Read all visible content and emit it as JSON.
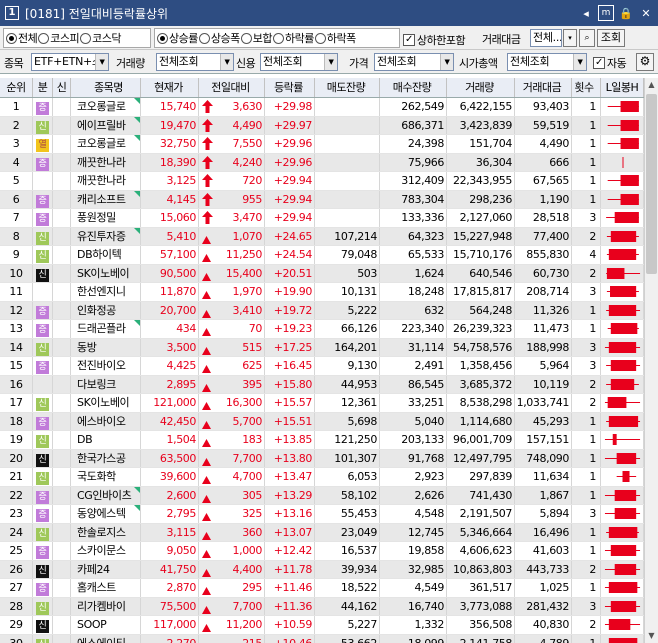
{
  "title": {
    "number": "1",
    "code": "[0181]",
    "name": "전일대비등락률상위",
    "btn_m": "m",
    "btn_lock": "🔒",
    "btn_close": "✕",
    "btn_more": "◂"
  },
  "filters": {
    "market": [
      {
        "label": "전체",
        "on": true
      },
      {
        "label": "코스피",
        "on": false
      },
      {
        "label": "코스닥",
        "on": false
      }
    ],
    "type": [
      {
        "label": "상승률",
        "on": true
      },
      {
        "label": "상승폭",
        "on": false
      },
      {
        "label": "보합",
        "on": false
      },
      {
        "label": "하락률",
        "on": false
      },
      {
        "label": "하락폭",
        "on": false
      }
    ],
    "include_limit": "상하한포함",
    "trade_amount_label": "거래대금",
    "trade_amount_value": "전체...",
    "query_button": "조회",
    "item_label": "종목",
    "item_value": "ETF+ETN+스!",
    "volume_label": "거래량",
    "volume_value": "전체조회",
    "credit_label": "신용",
    "credit_value": "전체조회",
    "price_label": "가격",
    "price_value": "전체조회",
    "mcap_label": "시가총액",
    "mcap_value": "전체조회",
    "auto_label": "자동"
  },
  "columns": [
    "순위",
    "분",
    "신",
    "종목명",
    "현재가",
    "전일대비",
    "등락률",
    "매도잔량",
    "매수잔량",
    "거래량",
    "거래대금",
    "횟수",
    "L일봉H"
  ],
  "rows": [
    {
      "rank": "1",
      "badge": "증",
      "bc": "p",
      "name": "코오롱글로",
      "corner": true,
      "price": "15,740",
      "arrow": "up",
      "chg": "3,630",
      "rate": "+29.98",
      "ask": "",
      "bid": "262,549",
      "vol": "6,422,155",
      "amt": "93,403",
      "cnt": "1",
      "k": [
        0.12,
        0.92,
        0.45,
        0.92
      ]
    },
    {
      "rank": "2",
      "badge": "신",
      "bc": "g",
      "name": "에이프릴바",
      "corner": true,
      "price": "19,470",
      "arrow": "up",
      "chg": "4,490",
      "rate": "+29.97",
      "ask": "",
      "bid": "686,371",
      "vol": "3,423,839",
      "amt": "59,519",
      "cnt": "1",
      "k": [
        0.12,
        0.92,
        0.45,
        0.92
      ]
    },
    {
      "rank": "3",
      "badge": "열",
      "bc": "y",
      "name": "코오롱글로",
      "corner": true,
      "price": "32,750",
      "arrow": "up",
      "chg": "7,550",
      "rate": "+29.96",
      "ask": "",
      "bid": "24,398",
      "vol": "151,704",
      "amt": "4,490",
      "cnt": "1",
      "k": [
        0.12,
        0.92,
        0.45,
        0.92
      ]
    },
    {
      "rank": "4",
      "badge": "증",
      "bc": "p",
      "name": "깨끗한나라",
      "corner": false,
      "price": "18,390",
      "arrow": "up",
      "chg": "4,240",
      "rate": "+29.96",
      "ask": "",
      "bid": "75,966",
      "vol": "36,304",
      "amt": "666",
      "cnt": "1",
      "k": [
        0.5,
        0.52,
        0.5,
        0.52
      ]
    },
    {
      "rank": "5",
      "badge": "",
      "bc": "",
      "name": "깨끗한나라",
      "corner": false,
      "price": "3,125",
      "arrow": "up",
      "chg": "720",
      "rate": "+29.94",
      "ask": "",
      "bid": "312,409",
      "vol": "22,343,955",
      "amt": "67,565",
      "cnt": "1",
      "k": [
        0.12,
        0.92,
        0.45,
        0.92
      ]
    },
    {
      "rank": "6",
      "badge": "증",
      "bc": "p",
      "name": "캐리소프트",
      "corner": true,
      "price": "4,145",
      "arrow": "up",
      "chg": "955",
      "rate": "+29.94",
      "ask": "",
      "bid": "783,304",
      "vol": "298,236",
      "amt": "1,190",
      "cnt": "1",
      "k": [
        0.12,
        0.92,
        0.45,
        0.92
      ]
    },
    {
      "rank": "7",
      "badge": "증",
      "bc": "p",
      "name": "풍원정밀",
      "corner": false,
      "price": "15,060",
      "arrow": "up",
      "chg": "3,470",
      "rate": "+29.94",
      "ask": "",
      "bid": "133,336",
      "vol": "2,127,060",
      "amt": "28,518",
      "cnt": "3",
      "k": [
        0.08,
        0.92,
        0.3,
        0.92
      ]
    },
    {
      "rank": "8",
      "badge": "신",
      "bc": "g",
      "name": "유진투자증",
      "corner": true,
      "price": "5,410",
      "arrow": "tri",
      "chg": "1,070",
      "rate": "+24.65",
      "ask": "107,214",
      "bid": "64,323",
      "vol": "15,227,948",
      "amt": "77,400",
      "cnt": "2",
      "k": [
        0.1,
        0.92,
        0.2,
        0.85
      ]
    },
    {
      "rank": "9",
      "badge": "신",
      "bc": "g",
      "name": "DB하이텍",
      "corner": false,
      "price": "57,100",
      "arrow": "tri",
      "chg": "11,250",
      "rate": "+24.54",
      "ask": "79,048",
      "bid": "65,533",
      "vol": "15,710,176",
      "amt": "855,830",
      "cnt": "4",
      "k": [
        0.1,
        0.92,
        0.15,
        0.85
      ]
    },
    {
      "rank": "10",
      "badge": "신",
      "bc": "k",
      "name": "SK이노베이",
      "corner": false,
      "price": "90,500",
      "arrow": "tri",
      "chg": "15,400",
      "rate": "+20.51",
      "ask": "503",
      "bid": "1,624",
      "vol": "640,546",
      "amt": "60,730",
      "cnt": "2",
      "k": [
        0.08,
        0.95,
        0.1,
        0.55
      ]
    },
    {
      "rank": "11",
      "badge": "",
      "bc": "",
      "name": "한선엔지니",
      "corner": false,
      "price": "11,870",
      "arrow": "tri",
      "chg": "1,970",
      "rate": "+19.90",
      "ask": "10,131",
      "bid": "18,248",
      "vol": "17,815,817",
      "amt": "208,714",
      "cnt": "3",
      "k": [
        0.1,
        0.92,
        0.18,
        0.85
      ]
    },
    {
      "rank": "12",
      "badge": "증",
      "bc": "p",
      "name": "인화정공",
      "corner": false,
      "price": "20,700",
      "arrow": "tri",
      "chg": "3,410",
      "rate": "+19.72",
      "ask": "5,222",
      "bid": "632",
      "vol": "564,248",
      "amt": "11,326",
      "cnt": "1",
      "k": [
        0.08,
        0.95,
        0.15,
        0.85
      ]
    },
    {
      "rank": "13",
      "badge": "증",
      "bc": "p",
      "name": "드래곤플라",
      "corner": true,
      "price": "434",
      "arrow": "tri",
      "chg": "70",
      "rate": "+19.23",
      "ask": "66,126",
      "bid": "223,340",
      "vol": "26,239,323",
      "amt": "11,473",
      "cnt": "1",
      "k": [
        0.12,
        0.92,
        0.2,
        0.88
      ]
    },
    {
      "rank": "14",
      "badge": "신",
      "bc": "g",
      "name": "동방",
      "corner": false,
      "price": "3,500",
      "arrow": "tri",
      "chg": "515",
      "rate": "+17.25",
      "ask": "164,201",
      "bid": "31,114",
      "vol": "54,758,576",
      "amt": "188,998",
      "cnt": "3",
      "k": [
        0.05,
        0.95,
        0.15,
        0.85
      ]
    },
    {
      "rank": "15",
      "badge": "증",
      "bc": "p",
      "name": "전진바이오",
      "corner": false,
      "price": "4,425",
      "arrow": "tri",
      "chg": "625",
      "rate": "+16.45",
      "ask": "9,130",
      "bid": "2,491",
      "vol": "1,358,456",
      "amt": "5,964",
      "cnt": "3",
      "k": [
        0.08,
        0.95,
        0.2,
        0.85
      ]
    },
    {
      "rank": "16",
      "badge": "",
      "bc": "",
      "name": "다보링크",
      "corner": false,
      "price": "2,895",
      "arrow": "tri",
      "chg": "395",
      "rate": "+15.80",
      "ask": "44,953",
      "bid": "86,545",
      "vol": "3,685,372",
      "amt": "10,119",
      "cnt": "2",
      "k": [
        0.08,
        0.92,
        0.2,
        0.8
      ]
    },
    {
      "rank": "17",
      "badge": "신",
      "bc": "g",
      "name": "SK이노베이",
      "corner": false,
      "price": "121,000",
      "arrow": "tri",
      "chg": "16,300",
      "rate": "+15.57",
      "ask": "12,361",
      "bid": "33,251",
      "vol": "8,538,298",
      "amt": "1,033,741",
      "cnt": "2",
      "k": [
        0.05,
        0.95,
        0.12,
        0.6
      ]
    },
    {
      "rank": "18",
      "badge": "증",
      "bc": "p",
      "name": "에스바이오",
      "corner": false,
      "price": "42,450",
      "arrow": "tri",
      "chg": "5,700",
      "rate": "+15.51",
      "ask": "5,698",
      "bid": "5,040",
      "vol": "1,114,680",
      "amt": "45,293",
      "cnt": "1",
      "k": [
        0.08,
        0.95,
        0.15,
        0.9
      ]
    },
    {
      "rank": "19",
      "badge": "신",
      "bc": "g",
      "name": "DB",
      "corner": false,
      "price": "1,504",
      "arrow": "tri",
      "chg": "183",
      "rate": "+13.85",
      "ask": "121,250",
      "bid": "203,133",
      "vol": "96,001,709",
      "amt": "157,151",
      "cnt": "1",
      "k": [
        0.05,
        0.95,
        0.25,
        0.35
      ]
    },
    {
      "rank": "20",
      "badge": "신",
      "bc": "k",
      "name": "한국가스공",
      "corner": false,
      "price": "63,500",
      "arrow": "tri",
      "chg": "7,700",
      "rate": "+13.80",
      "ask": "101,307",
      "bid": "91,768",
      "vol": "12,497,795",
      "amt": "748,090",
      "cnt": "1",
      "k": [
        0.05,
        0.95,
        0.35,
        0.85
      ]
    },
    {
      "rank": "21",
      "badge": "신",
      "bc": "g",
      "name": "국도화학",
      "corner": false,
      "price": "39,600",
      "arrow": "tri",
      "chg": "4,700",
      "rate": "+13.47",
      "ask": "6,053",
      "bid": "2,923",
      "vol": "297,839",
      "amt": "11,634",
      "cnt": "1",
      "k": [
        0.35,
        0.85,
        0.5,
        0.68
      ]
    },
    {
      "rank": "22",
      "badge": "증",
      "bc": "p",
      "name": "CG인바이츠",
      "corner": true,
      "price": "2,600",
      "arrow": "tri",
      "chg": "305",
      "rate": "+13.29",
      "ask": "58,102",
      "bid": "2,626",
      "vol": "741,430",
      "amt": "1,867",
      "cnt": "1",
      "k": [
        0.05,
        0.95,
        0.3,
        0.85
      ]
    },
    {
      "rank": "23",
      "badge": "증",
      "bc": "p",
      "name": "동양에스텍",
      "corner": true,
      "price": "2,795",
      "arrow": "tri",
      "chg": "325",
      "rate": "+13.16",
      "ask": "55,453",
      "bid": "4,548",
      "vol": "2,191,507",
      "amt": "5,894",
      "cnt": "3",
      "k": [
        0.05,
        0.95,
        0.3,
        0.85
      ]
    },
    {
      "rank": "24",
      "badge": "신",
      "bc": "g",
      "name": "한솔로지스",
      "corner": false,
      "price": "3,115",
      "arrow": "tri",
      "chg": "360",
      "rate": "+13.07",
      "ask": "23,049",
      "bid": "12,745",
      "vol": "5,346,664",
      "amt": "16,496",
      "cnt": "1",
      "k": [
        0.08,
        0.92,
        0.15,
        0.88
      ]
    },
    {
      "rank": "25",
      "badge": "증",
      "bc": "p",
      "name": "스카이문스",
      "corner": false,
      "price": "9,050",
      "arrow": "tri",
      "chg": "1,000",
      "rate": "+12.42",
      "ask": "16,537",
      "bid": "19,858",
      "vol": "4,606,623",
      "amt": "41,603",
      "cnt": "1",
      "k": [
        0.05,
        0.95,
        0.2,
        0.85
      ]
    },
    {
      "rank": "26",
      "badge": "신",
      "bc": "k",
      "name": "카페24",
      "corner": false,
      "price": "41,750",
      "arrow": "tri",
      "chg": "4,400",
      "rate": "+11.78",
      "ask": "39,934",
      "bid": "32,985",
      "vol": "10,863,803",
      "amt": "443,733",
      "cnt": "2",
      "k": [
        0.05,
        0.95,
        0.3,
        0.85
      ]
    },
    {
      "rank": "27",
      "badge": "증",
      "bc": "p",
      "name": "홈캐스트",
      "corner": false,
      "price": "2,870",
      "arrow": "tri",
      "chg": "295",
      "rate": "+11.46",
      "ask": "18,522",
      "bid": "4,549",
      "vol": "361,517",
      "amt": "1,025",
      "cnt": "1",
      "k": [
        0.05,
        0.95,
        0.15,
        0.88
      ]
    },
    {
      "rank": "28",
      "badge": "신",
      "bc": "g",
      "name": "리가켐바이",
      "corner": false,
      "price": "75,500",
      "arrow": "tri",
      "chg": "7,700",
      "rate": "+11.36",
      "ask": "44,162",
      "bid": "16,740",
      "vol": "3,773,088",
      "amt": "281,432",
      "cnt": "3",
      "k": [
        0.05,
        0.95,
        0.2,
        0.85
      ]
    },
    {
      "rank": "29",
      "badge": "신",
      "bc": "k",
      "name": "SOOP",
      "corner": false,
      "price": "117,000",
      "arrow": "tri",
      "chg": "11,200",
      "rate": "+10.59",
      "ask": "5,227",
      "bid": "1,332",
      "vol": "356,508",
      "amt": "40,830",
      "cnt": "2",
      "k": [
        0.05,
        0.95,
        0.15,
        0.7
      ]
    },
    {
      "rank": "30",
      "badge": "신",
      "bc": "g",
      "name": "에스에이티",
      "corner": false,
      "price": "2,270",
      "arrow": "tri",
      "chg": "215",
      "rate": "+10.46",
      "ask": "53,662",
      "bid": "18,099",
      "vol": "2,141,758",
      "amt": "4,789",
      "cnt": "1",
      "k": [
        0.05,
        0.95,
        0.15,
        0.88
      ]
    }
  ]
}
